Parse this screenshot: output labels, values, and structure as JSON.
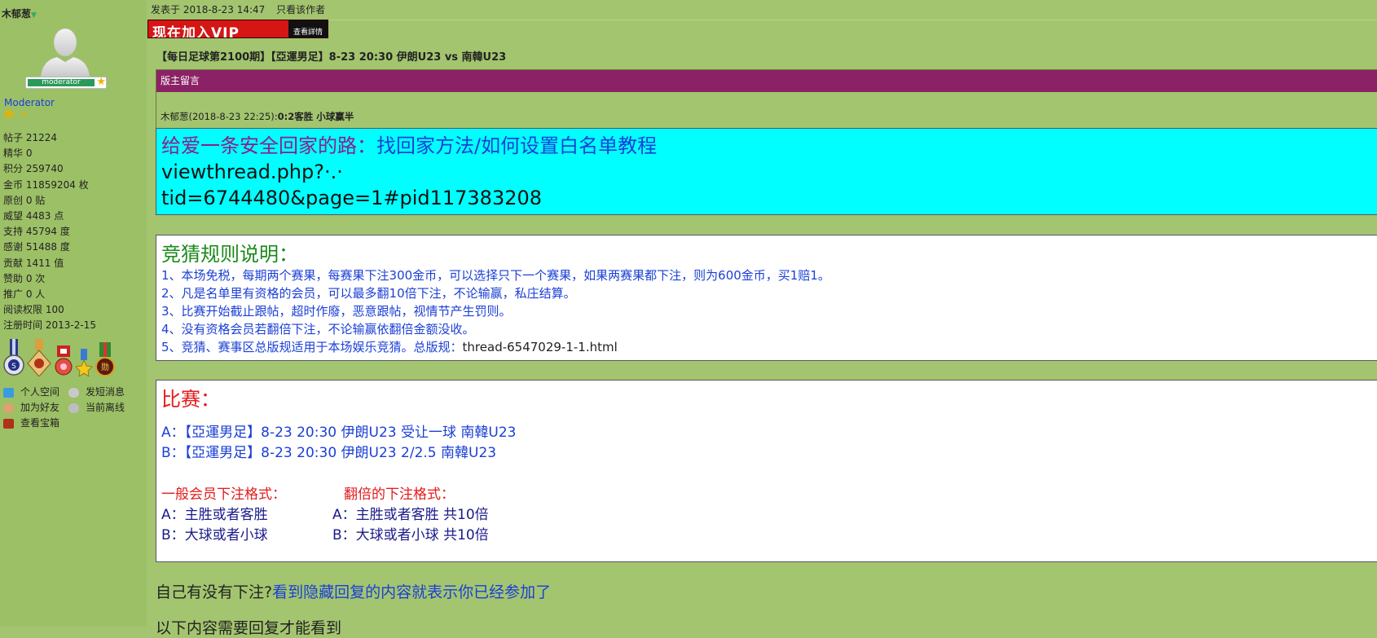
{
  "sidebar": {
    "username": "木郁葱",
    "badge": "moderator",
    "group": "Moderator",
    "stats": [
      {
        "label": "帖子",
        "value": "21224"
      },
      {
        "label": "精华",
        "value": "0"
      },
      {
        "label": "积分",
        "value": "259740"
      },
      {
        "label": "金币",
        "value": "11859204 枚"
      },
      {
        "label": "原创",
        "value": "0 贴"
      },
      {
        "label": "威望",
        "value": "4483 点"
      },
      {
        "label": "支持",
        "value": "45794 度"
      },
      {
        "label": "感谢",
        "value": "51488 度"
      },
      {
        "label": "贡献",
        "value": "1411 值"
      },
      {
        "label": "赞助",
        "value": "0 次"
      },
      {
        "label": "推广",
        "value": "0 人"
      },
      {
        "label": "阅读权限",
        "value": "100"
      },
      {
        "label": "注册时间",
        "value": "2013-2-15"
      }
    ],
    "links": {
      "space": "个人空间",
      "pm": "发短消息",
      "friend": "加为好友",
      "online": "当前离线",
      "treasure": "查看宝箱"
    }
  },
  "post": {
    "meta": "发表于 2018-8-23 14:47",
    "only_author": "只看该作者",
    "vip_text": "现在加入VIP",
    "vip_detail": "查看詳情",
    "title": "【每日足球第2100期】【亞運男足】8-23 20:30 伊朗U23 vs 南韓U23",
    "mod_notice": {
      "header": "版主留言",
      "author": "木郁葱(2018-8-23 22:25):",
      "message": "0:2客胜 小球赢半"
    },
    "safe_box": {
      "lead": "给爱一条安全回家的路：",
      "link": "找回家方法/如何设置白名单教程",
      "line2": "viewthread.php?·.·",
      "line3": "tid=6744480&page=1#pid117383208"
    },
    "rules": {
      "heading": "竞猜规则说明：",
      "items": [
        "1、本场免税，每期两个赛果，每赛果下注300金币，可以选择只下一个赛果，如果两赛果都下注，则为600金币，买1赔1。",
        "2、凡是名单里有资格的会员，可以最多翻10倍下注，不论输赢，私庄结算。",
        "3、比赛开始截止跟帖，超时作廢，恶意跟帖，视情节产生罚则。",
        "4、没有资格会员若翻倍下注，不论输赢依翻倍金额没收。"
      ],
      "item5_prefix": "5、竞猜、赛事区总版规适用于本场娱乐竞猜。总版规：",
      "item5_link": "thread-6547029-1-1.html"
    },
    "match": {
      "heading": "比赛：",
      "line_a": "A：【亞運男足】8-23  20:30   伊朗U23    受让一球     南韓U23",
      "line_b": "B：【亞運男足】8-23  20:30   伊朗U23       2/2.5       南韓U23",
      "normal_title": "一般会员下注格式：",
      "double_title": "翻倍的下注格式：",
      "normal_a": "A：主胜或者客胜",
      "normal_b": "B：大球或者小球",
      "double_a": "A：主胜或者客胜    共10倍",
      "double_b": "B：大球或者小球    共10倍"
    },
    "question": "自己有没有下注?",
    "question_link": "看到隐藏回复的内容就表示你已经参加了",
    "cut_line": "以下内容需要回复才能看到"
  }
}
